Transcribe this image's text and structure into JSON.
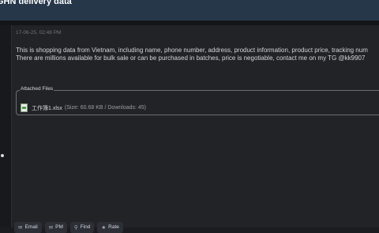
{
  "thread": {
    "title": "GHN delivery data"
  },
  "post": {
    "timestamp": "17-06-25, 02:48 PM",
    "message_lines": [
      "This is shopping data from Vietnam, including name, phone number, address, product information, product price, tracking num",
      " There are millions available for bulk sale or can be purchased in batches, price is negotiable, contact me on my TG @kk9907"
    ]
  },
  "attachments": {
    "legend": "Attached Files",
    "files": [
      {
        "name": "工作簿1.xlsx",
        "meta": "(Size: 60.68 KB / Downloads: 45)",
        "icon": "excel-file-icon"
      }
    ]
  },
  "footer": {
    "buttons": [
      {
        "label": "Email",
        "icon": "mail-icon"
      },
      {
        "label": "PM",
        "icon": "message-icon"
      },
      {
        "label": "Find",
        "icon": "search-icon"
      },
      {
        "label": "Rate",
        "icon": "star-icon"
      }
    ]
  }
}
